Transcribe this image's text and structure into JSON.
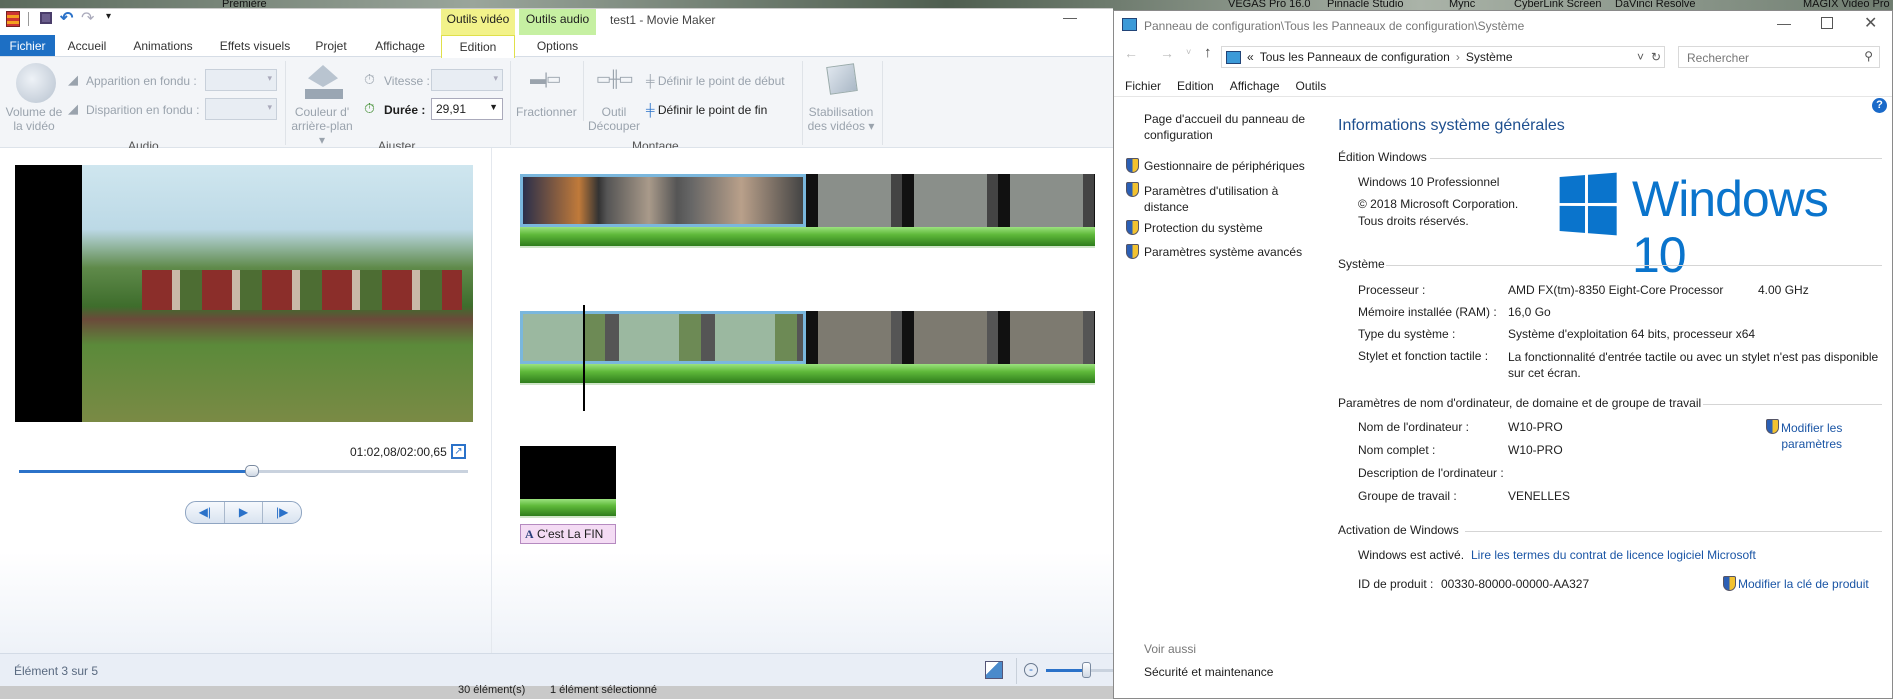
{
  "desktop": {
    "labels": [
      "Première",
      "VEGAS Pro 16.0",
      "Pinnacle Studio",
      "Mync",
      "CyberLink Screen",
      "DaVinci Resolve",
      "MAGIX Video Pro"
    ]
  },
  "movie_maker": {
    "title": "test1 - Movie Maker",
    "context_tabs": [
      {
        "label": "Outils vidéo",
        "color": "#f2f28a"
      },
      {
        "label": "Outils audio",
        "color": "#c6f0a2"
      }
    ],
    "tabs": [
      {
        "label": "Fichier"
      },
      {
        "label": "Accueil"
      },
      {
        "label": "Animations"
      },
      {
        "label": "Effets visuels"
      },
      {
        "label": "Projet"
      },
      {
        "label": "Affichage"
      },
      {
        "label": "Edition",
        "selected": true
      },
      {
        "label": "Options"
      }
    ],
    "ribbon": {
      "audio": {
        "volume": "Volume de",
        "volume2": "la vidéo",
        "fade_in": "Apparition en fondu :",
        "fade_out": "Disparition en fondu :",
        "group": "Audio"
      },
      "adjust": {
        "bg_color": "Couleur d'",
        "bg_color2": "arrière-plan",
        "speed": "Vitesse :",
        "duration": "Durée :",
        "duration_value": "29,91",
        "group": "Ajuster"
      },
      "montage": {
        "split": "Fractionner",
        "trim": "Outil",
        "trim2": "Découper",
        "set_start": "Définir le point de début",
        "set_end": "Définir le point de fin",
        "group": "Montage"
      },
      "stab": {
        "label": "Stabilisation",
        "label2": "des vidéos"
      }
    },
    "preview": {
      "time": "01:02,08/02:00,65",
      "progress": 0.52
    },
    "storyboard": {
      "caption": "C'est La FIN"
    },
    "status": {
      "text": "Élément 3 sur 5",
      "zoom_level": 0.6
    },
    "behind": [
      "30 élément(s)",
      "1 élément sélectionné"
    ]
  },
  "control_panel": {
    "title": "Panneau de configuration\\Tous les Panneaux de configuration\\Système",
    "breadcrumb": [
      "Tous les Panneaux de configuration",
      "Système"
    ],
    "search_placeholder": "Rechercher",
    "menu": [
      "Fichier",
      "Edition",
      "Affichage",
      "Outils"
    ],
    "side": {
      "home": "Page d'accueil du panneau de",
      "home2": "configuration",
      "links": [
        "Gestionnaire de périphériques",
        "Paramètres d'utilisation à",
        "Protection du système",
        "Paramètres système avancés"
      ],
      "link1b": "distance",
      "see_also": "Voir aussi",
      "security": "Sécurité et maintenance"
    },
    "heading": "Informations système générales",
    "edition": {
      "title": "Édition Windows",
      "name": "Windows 10 Professionnel",
      "copyright": "© 2018 Microsoft Corporation.",
      "rights": "Tous droits réservés.",
      "logo": "Windows 10"
    },
    "system": {
      "title": "Système",
      "rows": [
        {
          "label": "Processeur :",
          "value": "AMD FX(tm)-8350 Eight-Core Processor",
          "extra": "4.00 GHz"
        },
        {
          "label": "Mémoire installée (RAM) :",
          "value": "16,0 Go"
        },
        {
          "label": "Type du système :",
          "value": "Système d'exploitation 64 bits, processeur x64"
        },
        {
          "label": "Stylet et fonction tactile :",
          "value": "La fonctionnalité d'entrée tactile ou avec un stylet n'est pas disponible",
          "value2": "sur cet écran."
        }
      ]
    },
    "computer": {
      "title": "Paramètres de nom d'ordinateur, de domaine et de groupe de travail",
      "rows": [
        {
          "label": "Nom de l'ordinateur :",
          "value": "W10-PRO"
        },
        {
          "label": "Nom complet :",
          "value": "W10-PRO"
        },
        {
          "label": "Description de l'ordinateur :",
          "value": ""
        },
        {
          "label": "Groupe de travail :",
          "value": "VENELLES"
        }
      ],
      "change": "Modifier les",
      "change2": "paramètres"
    },
    "activation": {
      "title": "Activation de Windows",
      "status": "Windows est activé.",
      "license_link": "Lire les termes du contrat de licence logiciel Microsoft",
      "product_id_label": "ID de produit :",
      "product_id": "00330-80000-00000-AA327",
      "change_key": "Modifier la clé de produit"
    }
  }
}
